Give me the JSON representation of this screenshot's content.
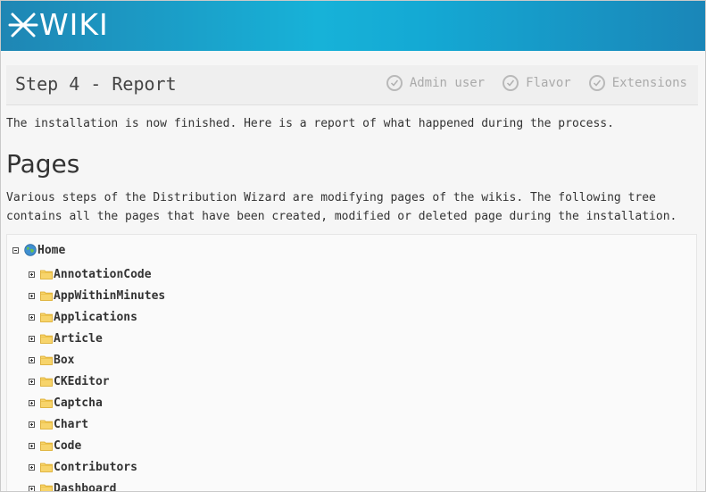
{
  "app": {
    "logo_text": "WIKI"
  },
  "step": {
    "title": "Step 4 - Report",
    "steps": [
      {
        "label": "Admin user"
      },
      {
        "label": "Flavor"
      },
      {
        "label": "Extensions"
      }
    ]
  },
  "intro": "The installation is now finished. Here is a report of what happened during the process.",
  "section": {
    "title": "Pages",
    "description": "Various steps of the Distribution Wizard are modifying pages of the wikis. The following tree contains all the pages that have been created, modified or deleted page during the installation."
  },
  "tree": {
    "root": "Home",
    "children": [
      {
        "label": "AnnotationCode"
      },
      {
        "label": "AppWithinMinutes"
      },
      {
        "label": "Applications"
      },
      {
        "label": "Article"
      },
      {
        "label": "Box"
      },
      {
        "label": "CKEditor"
      },
      {
        "label": "Captcha"
      },
      {
        "label": "Chart"
      },
      {
        "label": "Code"
      },
      {
        "label": "Contributors"
      },
      {
        "label": "Dashboard"
      }
    ]
  },
  "colors": {
    "header_start": "#1f86b4",
    "header_mid": "#17b2d8",
    "folder": "#f5c542"
  }
}
